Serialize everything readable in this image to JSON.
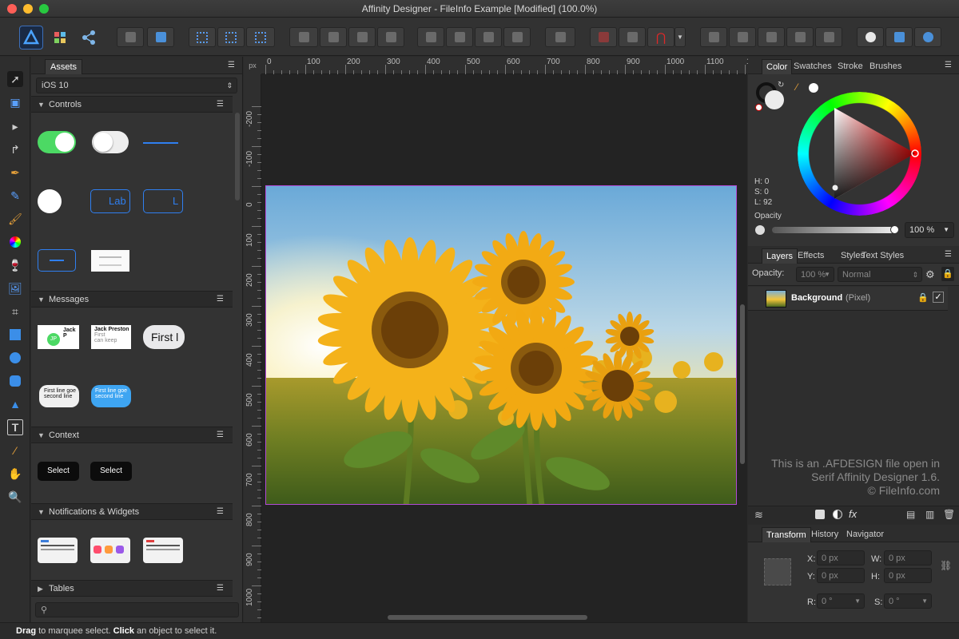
{
  "window": {
    "title": "Affinity Designer - FileInfo Example [Modified] (100.0%)"
  },
  "assets_panel": {
    "tab_label": "Assets",
    "category_select": "iOS 10",
    "sections": {
      "controls": "Controls",
      "messages": "Messages",
      "context": "Context",
      "notifications": "Notifications & Widgets",
      "tables": "Tables"
    },
    "assets": {
      "lab_1": "Lab",
      "lab_2": "L",
      "jack_1": "Jack P",
      "jack_2": "Jack Preston",
      "jack_sub_1": "First",
      "jack_sub_2": "can keep",
      "jp_initials": "JP",
      "first_bubble": "First l",
      "first_line_goes": "First line goe",
      "second_line": "second line",
      "first_line_goes_blue": "First line goe",
      "second_line_blue": "second line",
      "select_1": "Select",
      "select_2": "Select"
    },
    "search_placeholder": ""
  },
  "ruler": {
    "unit": "px",
    "h_labels": [
      "0",
      "100",
      "200",
      "300",
      "400",
      "500",
      "600",
      "700",
      "800",
      "900",
      "1000",
      "1100",
      "120"
    ],
    "v_labels": [
      "-200",
      "-100",
      "0",
      "100",
      "200",
      "300",
      "400",
      "500",
      "600",
      "700",
      "800",
      "900",
      "1000"
    ]
  },
  "color_panel": {
    "tabs": [
      "Color",
      "Swatches",
      "Stroke",
      "Brushes"
    ],
    "h": "H: 0",
    "s": "S: 0",
    "l": "L: 92",
    "opacity_label": "Opacity",
    "opacity_value": "100 %"
  },
  "layers_panel": {
    "tabs": [
      "Layers",
      "Effects",
      "Styles",
      "Text Styles"
    ],
    "opacity_label": "Opacity:",
    "opacity_value": "100 %",
    "blend_mode": "Normal",
    "layer_name": "Background",
    "layer_type": "(Pixel)"
  },
  "watermark": {
    "line1": "This is an .AFDESIGN file open in",
    "line2": "Serif Affinity Designer 1.6.",
    "line3": "© FileInfo.com"
  },
  "transform_panel": {
    "tabs": [
      "Transform",
      "History",
      "Navigator"
    ],
    "x_label": "X:",
    "y_label": "Y:",
    "w_label": "W:",
    "h_label": "H:",
    "r_label": "R:",
    "s_label": "S:",
    "x": "0 px",
    "y": "0 px",
    "w": "0 px",
    "h": "0 px",
    "r": "0 °",
    "s": "0 °"
  },
  "status_bar": {
    "drag": "Drag",
    "drag_text": " to marquee select. ",
    "click": "Click",
    "click_text": " an object to select it."
  },
  "colors": {
    "artboard_border": "#b14ad6",
    "accent_blue": "#2f7ff0",
    "toggle_green": "#4cd964"
  }
}
